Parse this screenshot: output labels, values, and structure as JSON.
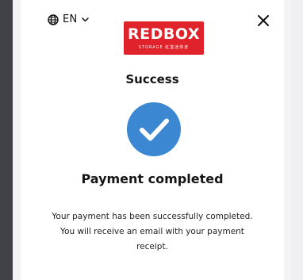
{
  "header": {
    "language": "EN",
    "logo_text": "REDBOX",
    "logo_subtext": "STORAGE 紅盒迷你倉"
  },
  "main": {
    "title": "Success",
    "heading": "Payment completed",
    "message": "Your payment has been successfully completed. You will receive an email with your payment receipt."
  },
  "colors": {
    "brand_red": "#e0222a",
    "success_blue": "#3b87d1"
  },
  "icons": {
    "language": "globe-icon",
    "dropdown": "chevron-down-icon",
    "close": "close-icon",
    "success": "check-circle-icon"
  }
}
